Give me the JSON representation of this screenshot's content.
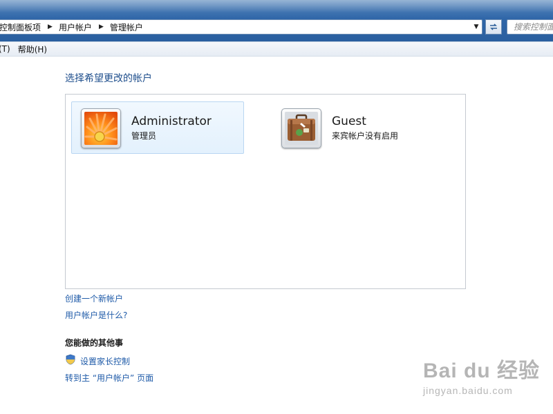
{
  "breadcrumb": [
    "控制面板项",
    "用户帐户",
    "管理帐户"
  ],
  "search": {
    "placeholder": "搜索控制面板"
  },
  "menu": {
    "items": [
      "(T)",
      "帮助(H)"
    ]
  },
  "page": {
    "title": "选择希望更改的帐户"
  },
  "accounts": [
    {
      "name": "Administrator",
      "subtitle": "管理员",
      "icon": "flower-icon",
      "selected": true
    },
    {
      "name": "Guest",
      "subtitle": "来宾帐户没有启用",
      "icon": "suitcase-icon",
      "selected": false
    }
  ],
  "links": {
    "create_account": "创建一个新帐户",
    "what_is_account": "用户帐户是什么?"
  },
  "other_tasks": {
    "heading": "您能做的其他事",
    "parental_controls": "设置家长控制",
    "go_main": "转到主 “用户帐户” 页面"
  },
  "watermark": {
    "top": "Bai du 经验",
    "bottom": "jingyan.baidu.com"
  },
  "colors": {
    "link": "#1e5aa8",
    "title": "#1e4e8c",
    "chrome": "#2f66a8",
    "selected_bg": "#e3f1fd"
  }
}
